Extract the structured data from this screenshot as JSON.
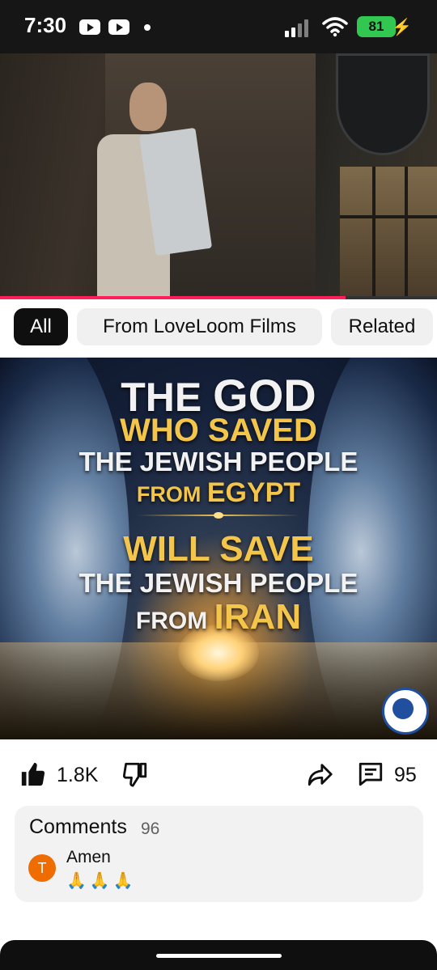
{
  "status_bar": {
    "time": "7:30",
    "battery": "81"
  },
  "video": {
    "progress": 0.79
  },
  "chips": [
    "All",
    "From LoveLoom Films",
    "Related"
  ],
  "poster": {
    "line1_a": "THE ",
    "line1_b": "GOD",
    "line2": "WHO SAVED",
    "line3": "THE JEWISH PEOPLE",
    "line4_a": "FROM ",
    "line4_b": "EGYPT",
    "line5": "WILL SAVE",
    "line6": "THE JEWISH PEOPLE",
    "line7_a": "FROM ",
    "line7_b": "IRAN"
  },
  "actions": {
    "likes": "1.8K",
    "comment_count": "95"
  },
  "comments": {
    "title": "Comments",
    "count": "96",
    "first": {
      "avatar_letter": "T",
      "text": "Amen",
      "emoji": "🙏🙏🙏"
    }
  },
  "colors": {
    "progress": "#ff1f5a",
    "battery": "#31c750",
    "poster_gold": "#f3c54b",
    "avatar": "#ef6c00"
  }
}
